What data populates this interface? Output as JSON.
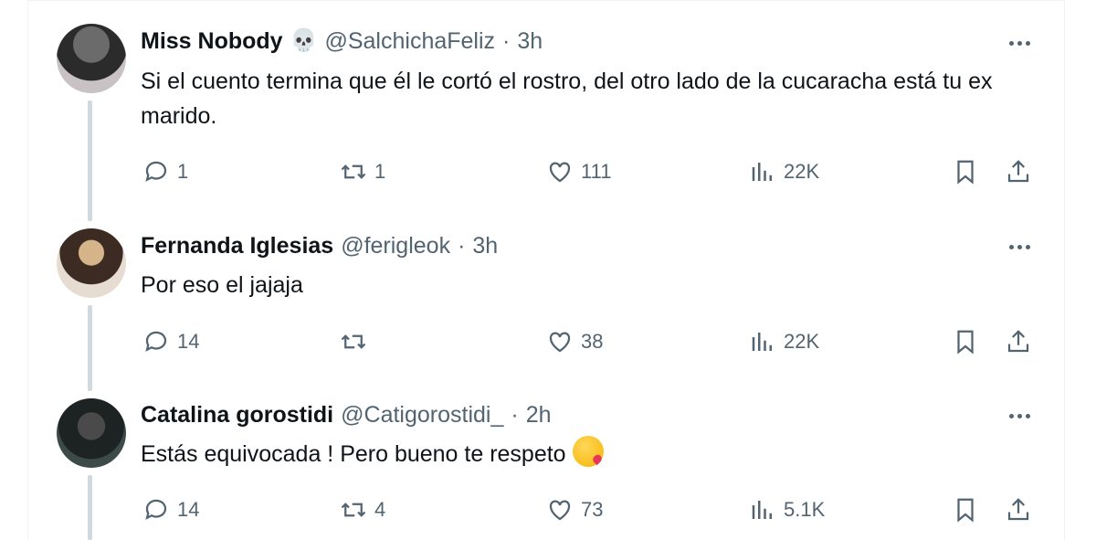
{
  "tweets": [
    {
      "name": "Miss Nobody",
      "name_emoji": "💀",
      "handle": "@SalchichaFeliz",
      "time": "3h",
      "text": "Si el cuento termina que él le cortó el rostro, del otro lado de la cucaracha está tu ex marido.",
      "replies": "1",
      "retweets": "1",
      "likes": "111",
      "views": "22K"
    },
    {
      "name": "Fernanda Iglesias",
      "handle": "@ferigleok",
      "time": "3h",
      "text": "Por eso el jajaja",
      "replies": "14",
      "retweets": "",
      "likes": "38",
      "views": "22K"
    },
    {
      "name": "Catalina gorostidi",
      "handle": "@Catigorostidi_",
      "time": "2h",
      "text": "Estás equivocada ! Pero bueno te respeto",
      "text_emoji": "face-blowing-kiss-emoji",
      "replies": "14",
      "retweets": "4",
      "likes": "73",
      "views": "5.1K"
    }
  ],
  "separator": "·",
  "colors": {
    "text": "#0f1419",
    "secondary": "#536471",
    "thread_line": "#cfd9de",
    "border": "#eff3f4"
  },
  "icons": [
    "reply-icon",
    "retweet-icon",
    "like-icon",
    "views-icon",
    "bookmark-icon",
    "share-icon",
    "more-icon"
  ]
}
